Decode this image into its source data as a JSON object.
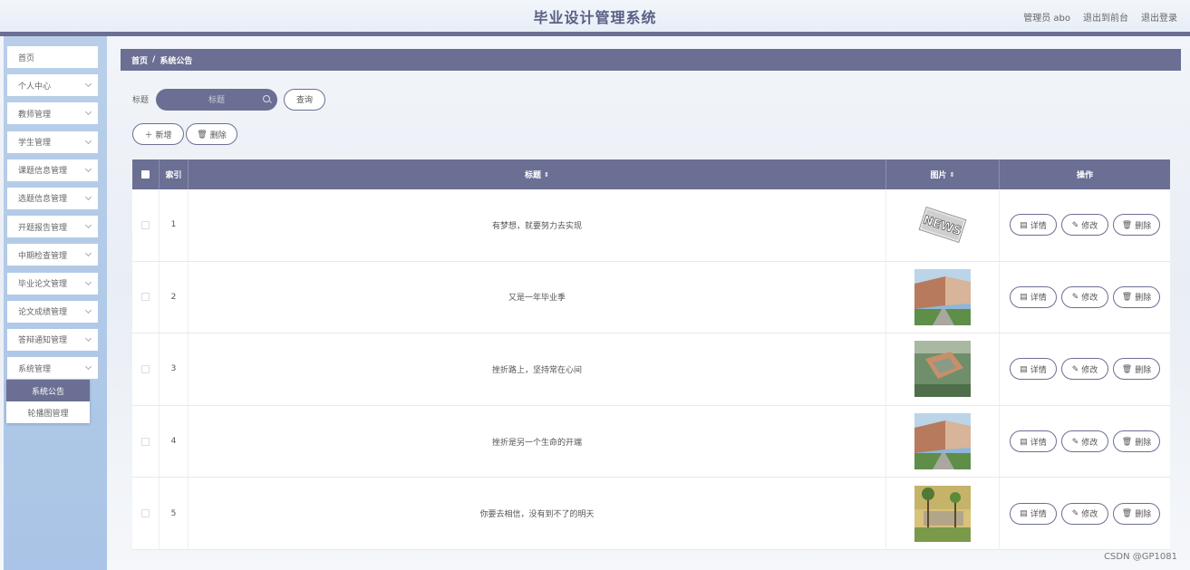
{
  "header": {
    "title": "毕业设计管理系统",
    "user": "管理员 abo",
    "back_to_front": "退出到前台",
    "logout": "退出登录"
  },
  "sidebar": {
    "items": [
      {
        "label": "首页",
        "has_chevron": false
      },
      {
        "label": "个人中心",
        "has_chevron": true
      },
      {
        "label": "教师管理",
        "has_chevron": true
      },
      {
        "label": "学生管理",
        "has_chevron": true
      },
      {
        "label": "课题信息管理",
        "has_chevron": true
      },
      {
        "label": "选题信息管理",
        "has_chevron": true
      },
      {
        "label": "开题报告管理",
        "has_chevron": true
      },
      {
        "label": "中期检查管理",
        "has_chevron": true
      },
      {
        "label": "毕业论文管理",
        "has_chevron": true
      },
      {
        "label": "论文成绩管理",
        "has_chevron": true
      },
      {
        "label": "答辩通知管理",
        "has_chevron": true
      },
      {
        "label": "系统管理",
        "has_chevron": true
      }
    ],
    "submenu": [
      {
        "label": "系统公告",
        "active": true
      },
      {
        "label": "轮播图管理",
        "active": false
      }
    ]
  },
  "breadcrumb": {
    "home": "首页",
    "sep": "/",
    "current": "系统公告"
  },
  "search": {
    "label": "标题",
    "placeholder": "标题",
    "query_button": "查询"
  },
  "actions": {
    "add": "新增",
    "delete": "删除"
  },
  "table": {
    "headers": {
      "index": "索引",
      "title": "标题",
      "image": "图片",
      "ops": "操作"
    },
    "sort_glyph": "⇕",
    "rows": [
      {
        "index": "1",
        "title": "有梦想，就要努力去实现",
        "image": "news"
      },
      {
        "index": "2",
        "title": "又是一年毕业季",
        "image": "campus"
      },
      {
        "index": "3",
        "title": "挫折路上，坚持常在心间",
        "image": "campus-aerial"
      },
      {
        "index": "4",
        "title": "挫折是另一个生命的开端",
        "image": "campus"
      },
      {
        "index": "5",
        "title": "你要去相信，没有到不了的明天",
        "image": "campus-palms"
      }
    ],
    "op_labels": {
      "detail": "详情",
      "edit": "修改",
      "delete": "删除"
    }
  },
  "watermark": "CSDN @GP1081",
  "colors": {
    "primary": "#6b6f93",
    "sidebar": "#b3cbe8"
  }
}
